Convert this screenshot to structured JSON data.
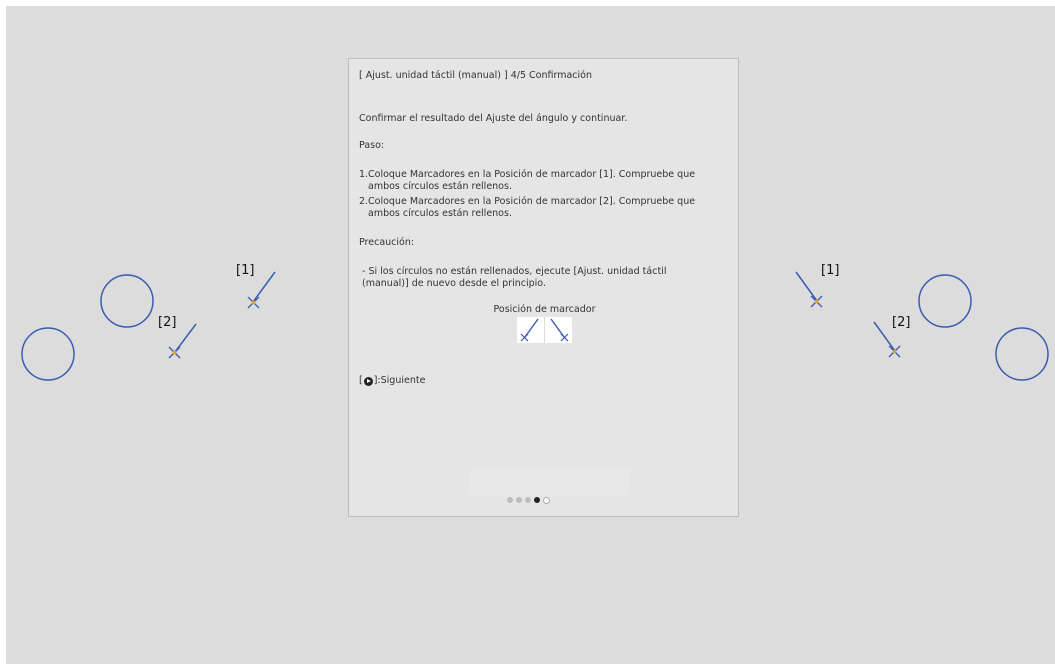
{
  "markers": {
    "label_1": "[1]",
    "label_2": "[2]"
  },
  "colors": {
    "background": "#dcdcdc",
    "circle": "#3a5bb0",
    "marker_line": "#3a5bb0",
    "marker_cross": "#e8a020"
  },
  "dialog": {
    "title": "[ Ajust. unidad táctil (manual) ]  4/5 Confirmación",
    "instruction": "Confirmar el resultado del Ajuste del ángulo y continuar.",
    "steps_heading": "Paso:",
    "steps": [
      {
        "num": "1.",
        "text": "Coloque Marcadores en la Posición de marcador [1]. Compruebe que ambos círculos están rellenos."
      },
      {
        "num": "2.",
        "text": "Coloque Marcadores en la Posición de marcador [2]. Compruebe que ambos círculos están rellenos."
      }
    ],
    "caution_heading": "Precaución:",
    "caution_text": "- Si los círculos no están rellenados, ejecute [Ajust. unidad táctil (manual)] de nuevo desde el principio.",
    "marker_position_title": "Posición de marcador",
    "next_prefix": "[",
    "next_label": "]:Siguiente",
    "next_icon": "enter-icon",
    "page_indicator": {
      "total": 5,
      "current": 4
    }
  }
}
